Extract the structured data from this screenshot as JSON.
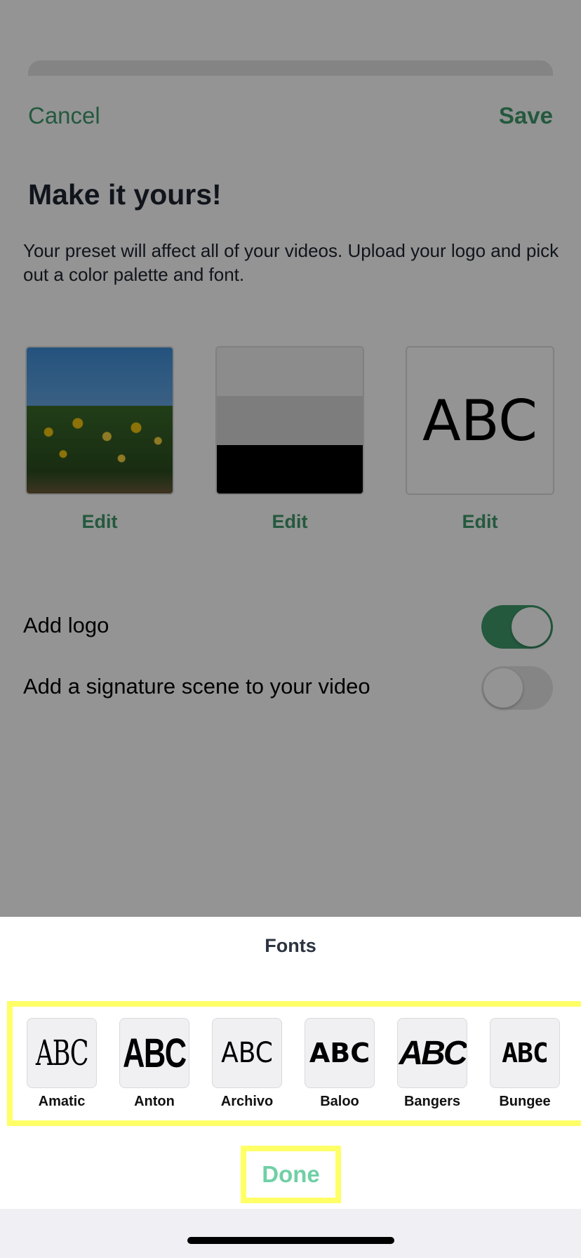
{
  "header": {
    "cancel_label": "Cancel",
    "save_label": "Save"
  },
  "intro": {
    "title": "Make it yours!",
    "description": "Your preset will affect all of your videos. Upload your logo and pick out a color palette and font."
  },
  "preset_tiles": {
    "logo_edit_label": "Edit",
    "palette_edit_label": "Edit",
    "font_edit_label": "Edit",
    "font_sample": "ABC",
    "palette_colors": [
      "#f2f2f2",
      "#d8d8d8",
      "#000000"
    ]
  },
  "settings": [
    {
      "label": "Add logo",
      "enabled": true
    },
    {
      "label": "Add a signature scene to your video",
      "enabled": false
    }
  ],
  "font_picker": {
    "title": "Fonts",
    "fonts": [
      {
        "name": "Amatic",
        "sample": "ABC"
      },
      {
        "name": "Anton",
        "sample": "ABC"
      },
      {
        "name": "Archivo",
        "sample": "ABC"
      },
      {
        "name": "Baloo",
        "sample": "ABC"
      },
      {
        "name": "Bangers",
        "sample": "ABC"
      },
      {
        "name": "Bungee",
        "sample": "ABC"
      }
    ],
    "done_label": "Done"
  },
  "colors": {
    "accent": "#3f9a6c",
    "done_accent": "#6fd0a5",
    "highlight": "#ffff66"
  }
}
